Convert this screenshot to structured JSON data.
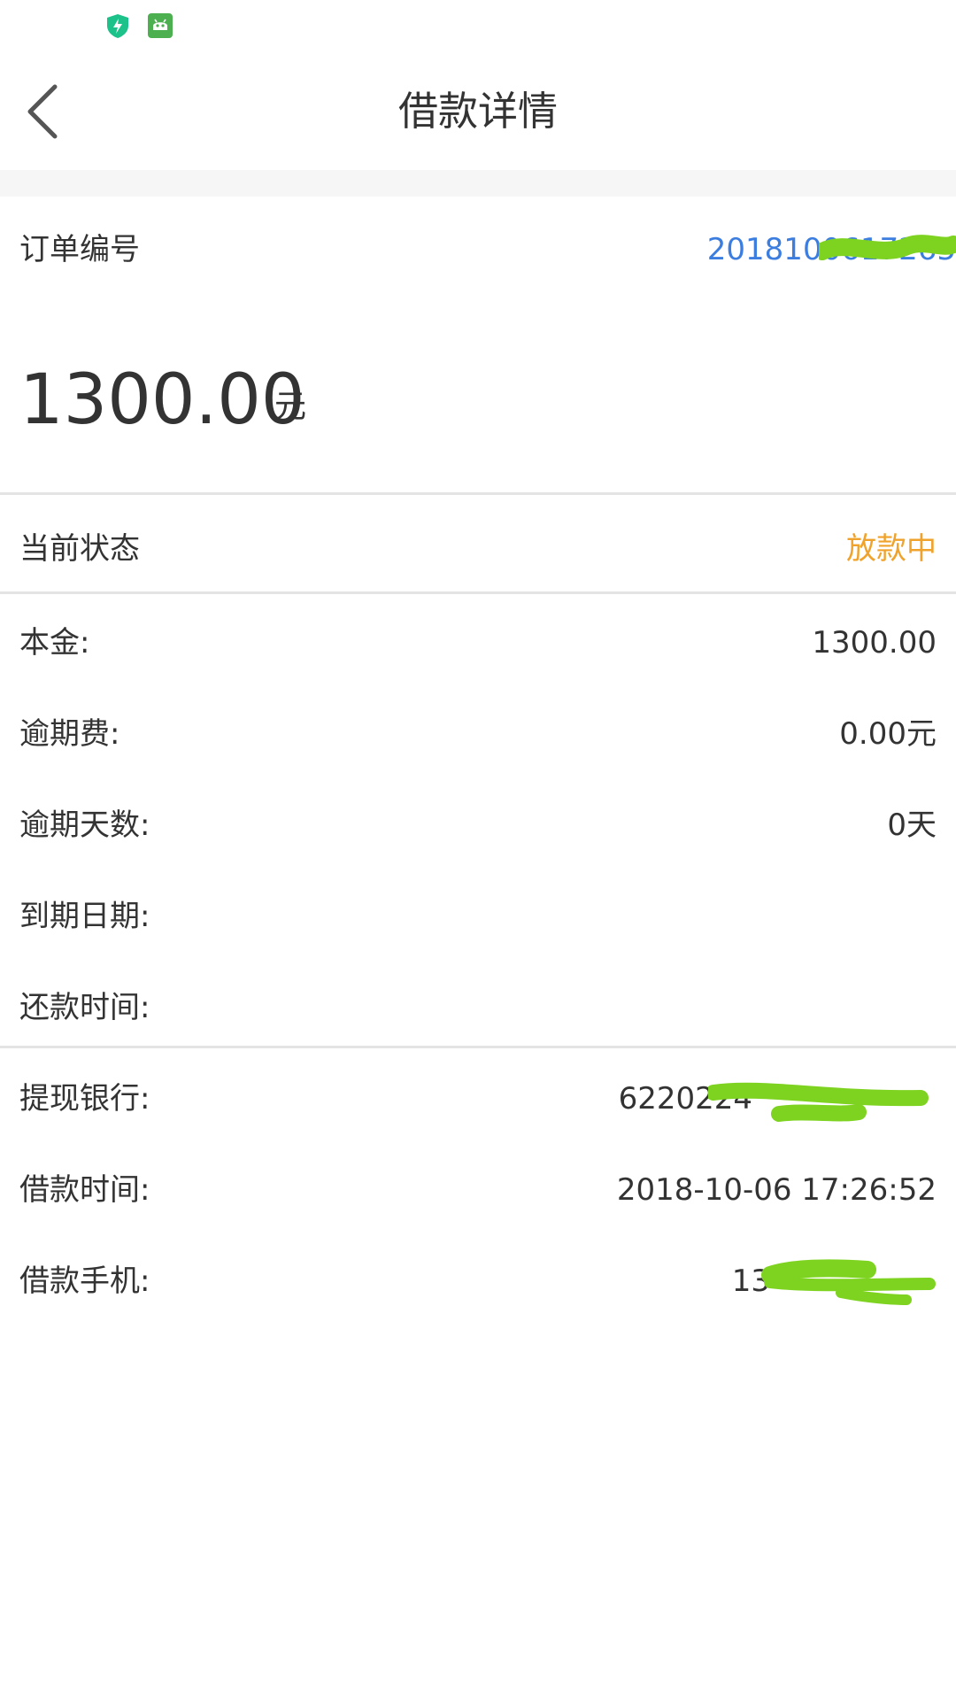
{
  "status_bar": {
    "icons": [
      "shield-bolt-icon",
      "android-robot-icon"
    ],
    "colors": {
      "shield": "#1cc28a",
      "robot": "#4caf50"
    }
  },
  "header": {
    "title": "借款详情",
    "back_icon": "chevron-left-icon"
  },
  "order": {
    "label": "订单编号",
    "value": "2018100617265"
  },
  "amount": {
    "value": "1300.00",
    "unit": "元"
  },
  "status": {
    "label": "当前状态",
    "value": "放款中",
    "color": "#f0a32c"
  },
  "details": [
    {
      "label": "本金:",
      "value": "1300.00"
    },
    {
      "label": "逾期费:",
      "value": "0.00元"
    },
    {
      "label": "逾期天数:",
      "value": "0天"
    },
    {
      "label": "到期日期:",
      "value": ""
    },
    {
      "label": "还款时间:",
      "value": ""
    }
  ],
  "extra": [
    {
      "label": "提现银行:",
      "value": "6220224"
    },
    {
      "label": "借款时间:",
      "value": "2018-10-06 17:26:52"
    },
    {
      "label": "借款手机:",
      "value": "13"
    }
  ],
  "colors": {
    "accent_blue": "#3c7de0",
    "redaction": "#7ed321"
  }
}
